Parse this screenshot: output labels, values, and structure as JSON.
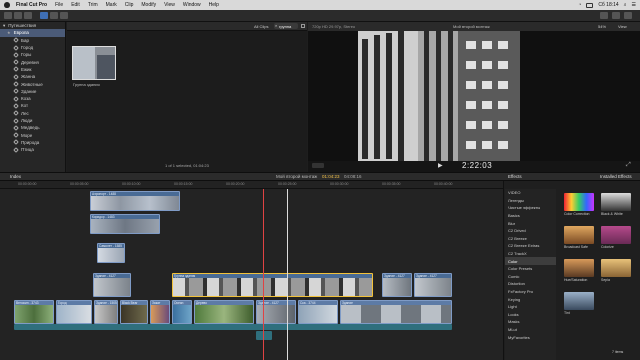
{
  "menubar": {
    "app": "Final Cut Pro",
    "items": [
      "File",
      "Edit",
      "Trim",
      "Mark",
      "Clip",
      "Modify",
      "View",
      "Window",
      "Help"
    ],
    "clock": "Сб 18:14"
  },
  "libraries": {
    "library": "Путешествия",
    "event": "Европа",
    "keywords": [
      "Бар",
      "Город",
      "Горы",
      "Деревня",
      "Ежик",
      "Жанна",
      "Животные",
      "Здание",
      "Коза",
      "Кот",
      "Лес",
      "Люди",
      "Медведь",
      "Море",
      "Природа",
      "Птица"
    ]
  },
  "browser": {
    "filter": "All Clips",
    "search_value": "группа",
    "clip_name": "Группа здания",
    "status": "1 of 1 selected, 01:04:23"
  },
  "viewer": {
    "format": "720p HD 29.97p, Stereo",
    "project": "Мой второй монтаж",
    "zoom": "54%",
    "view_menu": "View",
    "timecode": "2:22:03"
  },
  "timeline": {
    "index_label": "Index",
    "project": "Мой второй монтаж",
    "position": "01:04:23",
    "duration": "04:08:16",
    "ruler": [
      "00:00:00:00",
      "00:00:05:00",
      "00:00:10:00",
      "00:00:15:00",
      "00:00:20:00",
      "00:00:25:00",
      "00:00:30:00",
      "00:00:35:00",
      "00:00:40:00"
    ],
    "clips": {
      "c1": "Аэропорт - 1488",
      "c2": "Коридор - 1483",
      "c3": "Самолет - 1585",
      "c4": "Здание - 4127",
      "c5": "Группа здания",
      "c6": "Здание - 4127",
      "c7": "Здание - 4127",
      "c8": "Велосип - 3743",
      "c9": "Город",
      "c10": "Здание - 1505",
      "c11": "Black Bear",
      "c12": "Закат",
      "c13": "Ocean",
      "c14": "Дерево",
      "c15": "Здание - 4127",
      "c16": "Ска - 3744",
      "c17": "Здание"
    }
  },
  "effects": {
    "title": "Effects",
    "installed": "Installed Effects",
    "categories": [
      "VIDEO",
      "Легенды",
      "Чистые эффекты",
      "Basics",
      "Blur",
      "C2 Drived",
      "C2 Breeze",
      "C2 Breeze Extras",
      "C2 TrackX",
      "Color",
      "Color Presets",
      "Comic",
      "Distortion",
      "FxFactory Pro",
      "Keying",
      "Light",
      "Looks",
      "Masks",
      "MLut",
      "MyFavorites"
    ],
    "selected_category": "Color",
    "tiles": [
      "Black & White",
      "Color Correction",
      "Broadcast Safe",
      "Colorize",
      "Color Board",
      "Color Curves",
      "Hue/Saturation",
      "Sepia",
      "Tint",
      "Tint"
    ],
    "count": "7 items"
  }
}
